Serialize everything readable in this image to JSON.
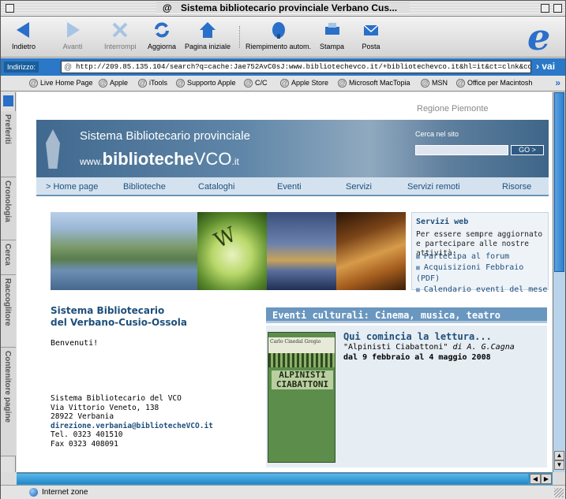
{
  "window": {
    "title": "Sistema bibliotecario provinciale Verbano Cus..."
  },
  "toolbar": {
    "back": "Indietro",
    "forward": "Avanti",
    "stop": "Interrompi",
    "refresh": "Aggiorna",
    "home": "Pagina iniziale",
    "autofill": "Riempimento autom.",
    "print": "Stampa",
    "mail": "Posta"
  },
  "address": {
    "label": "Indirizzo:",
    "url": "http://209.85.135.104/search?q=cache:Jae752AvC0sJ:www.bibliotechevco.it/+bibliotechevco.it&hl=it&ct=clnk&cd=1&gl=it&ie=UTF-8",
    "go": "vai"
  },
  "favorites": [
    "Live Home Page",
    "Apple",
    "iTools",
    "Supporto Apple",
    "C/C",
    "Apple Store",
    "Microsoft MacTopia",
    "MSN",
    "Office per Macintosh"
  ],
  "sidebar_tabs": [
    "Preferiti",
    "Cronologia",
    "Cerca",
    "Raccoglitore",
    "Contenitore pagine"
  ],
  "page": {
    "regione": "Regione Piemonte",
    "site_title": "Sistema Bibliotecario provinciale",
    "url_prefix": "www.",
    "url_bold": "biblioteche",
    "url_mid": "VCO",
    "url_suffix": ".it",
    "search_label": "Cerca nel sito",
    "search_button": "GO >",
    "nav": [
      "> Home page",
      "Biblioteche",
      "Cataloghi",
      "Eventi",
      "Servizi",
      "Servizi remoti",
      "Risorse"
    ],
    "servizi": {
      "title": "Servizi web",
      "desc": "Per essere sempre aggiornato e partecipare alle nostre attività:",
      "links": [
        "Partecipa al forum",
        "Acquisizioni Febbraio (PDF)",
        "Calendario eventi del mese"
      ]
    },
    "left_title_1": "Sistema Bibliotecario",
    "left_title_2": "del Verbano-Cusio-Ossola",
    "welcome": "Benvenuti!",
    "addr_lines": [
      "Sistema Bibliotecario del VCO",
      "Via Vittorio Veneto, 138",
      "28922 Verbania"
    ],
    "email": "direzione.verbania@bibliotecheVCO.it",
    "phone": "Tel. 0323 401510",
    "fax": "Fax 0323 408091",
    "eventi_header": "Eventi culturali: Cinema, musica, teatro",
    "book_band": "Carlo Cinedal Gregio",
    "book_title": "ALPINISTI CIABATTONI",
    "event_title": "Qui comincia la lettura...",
    "event_book": "\"Alpinisti Ciabattoni\"",
    "event_author": "di A. G.Cagna",
    "event_dates": "dal 9 febbraio al 4 maggio 2008"
  },
  "status": {
    "zone": "Internet zone"
  },
  "colors": {
    "accent": "#2a78c7",
    "link": "#1e4f7c",
    "nav_bg": "#d4e2ef"
  }
}
